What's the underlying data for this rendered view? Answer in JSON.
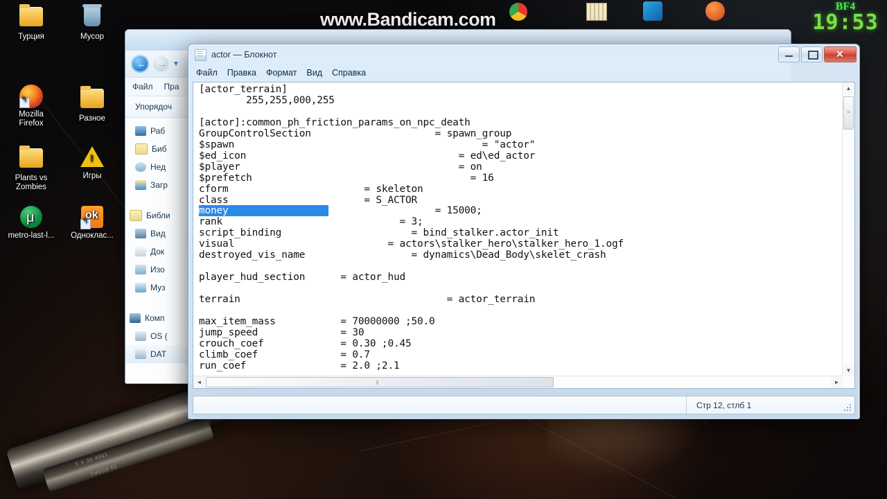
{
  "overlay": {
    "game_tag": "BF4",
    "clock": "19:53",
    "watermark": "www.Bandicam.com"
  },
  "desktop": {
    "icons": [
      {
        "label": "Турция",
        "icon": "folder-icon"
      },
      {
        "label": "Мусор",
        "icon": "recycle-bin-icon"
      },
      {
        "label": "Mozilla\nFirefox",
        "icon": "firefox-icon"
      },
      {
        "label": "Разное",
        "icon": "folder-icon"
      },
      {
        "label": "Plants vs\nZombies",
        "icon": "folder-icon"
      },
      {
        "label": "Игры",
        "icon": "warning-triangle-icon"
      },
      {
        "label": "metro-last-l...",
        "icon": "utorrent-icon"
      },
      {
        "label": "Одноклас...",
        "icon": "odnoklassniki-icon"
      }
    ]
  },
  "explorer": {
    "menu": [
      "Файл",
      "Пра"
    ],
    "toolbar": "Упорядоч",
    "sidebar": [
      {
        "label": "Раб",
        "icon": "desktop-icon"
      },
      {
        "label": "Биб",
        "icon": "library-icon"
      },
      {
        "label": "Нед",
        "icon": "recent-places-icon"
      },
      {
        "label": "Загр",
        "icon": "downloads-icon"
      },
      {
        "label": "Библи",
        "icon": "library-icon"
      },
      {
        "label": "Вид",
        "icon": "videos-icon"
      },
      {
        "label": "Док",
        "icon": "documents-icon"
      },
      {
        "label": "Изо",
        "icon": "pictures-icon"
      },
      {
        "label": "Муз",
        "icon": "music-icon"
      },
      {
        "label": "Комп",
        "icon": "computer-icon"
      },
      {
        "label": "OS (",
        "icon": "drive-icon"
      },
      {
        "label": "DAT",
        "icon": "drive-icon"
      }
    ]
  },
  "notepad": {
    "title": "actor — Блокнот",
    "menu": [
      "Файл",
      "Правка",
      "Формат",
      "Вид",
      "Справка"
    ],
    "window_buttons": {
      "minimize": "minimize-button",
      "maximize": "maximize-button",
      "close": "close-button"
    },
    "status_bar": "Стр 12, стлб 1",
    "selection": {
      "text": "money",
      "highlight_color": "#2a8ae8",
      "padded_width_chars": 22
    },
    "content_before_selection": "[actor_terrain]\n        255,255,000,255\n\n[actor]:common_ph_friction_params_on_npc_death\nGroupControlSection                     = spawn_group\n$spawn                                          = \"actor\"\n$ed_icon                                    = ed\\ed_actor\n$player                                     = on\n$prefetch                                     = 16\ncform                       = skeleton\nclass                       = S_ACTOR\n",
    "selection_line_suffix": "                  = 15000;",
    "content_after_selection": "\nrank                              = 3;\nscript_binding                      = bind_stalker.actor_init\nvisual                          = actors\\stalker_hero\\stalker_hero_1.ogf\ndestroyed_vis_name                  = dynamics\\Dead_Body\\skelet_crash\n\nplayer_hud_section      = actor_hud\n\nterrain                                   = actor_terrain\n\nmax_item_mass           = 70000000 ;50.0\njump_speed              = 30\ncrouch_coef             = 0.30 ;0.45\nclimb_coef              = 0.7\nrun_coef                = 2.0 ;2.1"
  },
  "scrollbars": {
    "vertical": {
      "up_arrow": "▲",
      "down_arrow": "▼",
      "thumb_top_pct": 4,
      "thumb_height_pct": 11
    },
    "horizontal": {
      "left_arrow": "◄",
      "right_arrow": "►",
      "thumb_left_pct": 2,
      "thumb_width_pct": 55
    }
  }
}
